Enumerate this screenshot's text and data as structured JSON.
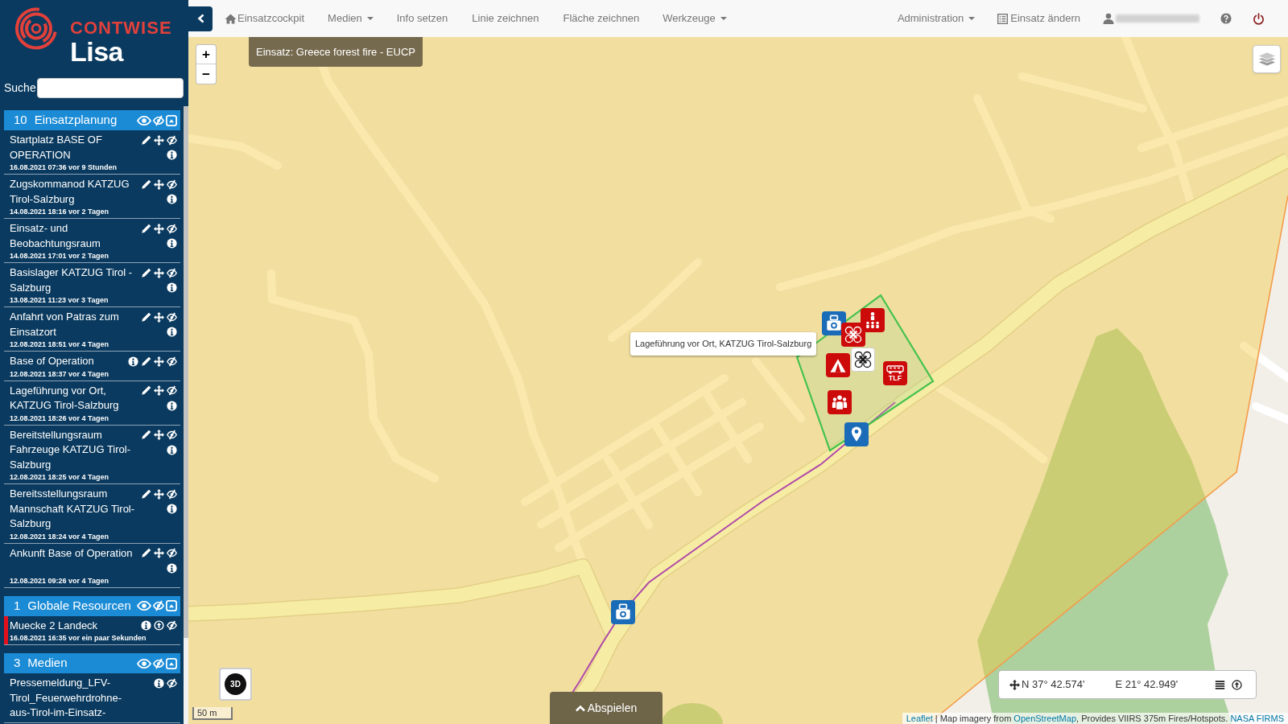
{
  "sidebar": {
    "logo": {
      "brand": "CONTWISE",
      "product": "Lisa"
    },
    "search": {
      "label": "Suche"
    },
    "groups": [
      {
        "count": "10",
        "title": "Einsatzplanung",
        "expanded": true,
        "items": [
          {
            "title": "Startplatz BASE OF OPERATION",
            "date": "16.08.2021 07:36 vor 9 Stunden",
            "kind": "feature"
          },
          {
            "title": "Zugskommanod KATZUG Tirol-Salzburg",
            "date": "14.08.2021 18:16 vor 2 Tagen",
            "kind": "feature"
          },
          {
            "title": "Einsatz- und Beobachtungsraum",
            "date": "14.08.2021 17:01 vor 2 Tagen",
            "kind": "feature"
          },
          {
            "title": "Basislager KATZUG Tirol - Salzburg",
            "date": "13.08.2021 11:23 vor 3 Tagen",
            "kind": "feature"
          },
          {
            "title": "Anfahrt von Patras zum Einsatzort",
            "date": "12.08.2021 18:51 vor 4 Tagen",
            "kind": "feature"
          },
          {
            "title": "Base of Operation",
            "date": "12.08.2021 18:37 vor 4 Tagen",
            "kind": "compact"
          },
          {
            "title": "Lageführung vor Ort, KATZUG Tirol-Salzburg",
            "date": "12.08.2021 18:26 vor 4 Tagen",
            "kind": "feature"
          },
          {
            "title": "Bereitstellungsraum Fahrzeuge KATZUG Tirol-Salzburg",
            "date": "12.08.2021 18:25 vor 4 Tagen",
            "kind": "feature"
          },
          {
            "title": "Bereitsstellungsraum Mannschaft KATZUG Tirol-Salzburg",
            "date": "12.08.2021 18:24 vor 4 Tagen",
            "kind": "feature"
          },
          {
            "title": "Ankunft Base of Operation",
            "date": "12.08.2021 09:26 vor 4 Tagen",
            "kind": "feature"
          }
        ]
      },
      {
        "count": "1",
        "title": "Globale Resourcen",
        "expanded": true,
        "items": [
          {
            "title": "Muecke 2 Landeck",
            "date": "16.08.2021 16:35 vor ein paar Sekunden",
            "kind": "resource",
            "color": "#e3101c"
          }
        ]
      },
      {
        "count": "3",
        "title": "Medien",
        "expanded": true,
        "items": [
          {
            "title": "Pressemeldung_LFV-Tirol_Feuerwehrdrohne-aus-Tirol-im-Einsatz-",
            "kind": "media"
          }
        ]
      }
    ]
  },
  "navbar": {
    "left": [
      {
        "label": "Einsatzcockpit",
        "kind": "home"
      },
      {
        "label": "Medien",
        "kind": "dropdown"
      },
      {
        "label": "Info setzen",
        "kind": "link"
      },
      {
        "label": "Linie zeichnen",
        "kind": "link"
      },
      {
        "label": "Fläche zeichnen",
        "kind": "link"
      },
      {
        "label": "Werkzeuge",
        "kind": "dropdown"
      }
    ],
    "right": [
      {
        "label": "Administration",
        "kind": "dropdown"
      },
      {
        "label": "Einsatz ändern",
        "kind": "form"
      },
      {
        "kind": "user"
      },
      {
        "kind": "help"
      },
      {
        "kind": "power"
      }
    ]
  },
  "map": {
    "mission_label": "Einsatz: Greece forest fire - EUCP",
    "zoom_controls": [
      "+",
      "−"
    ],
    "markers": [
      {
        "kind": "camera",
        "color": "#1a6cb8"
      },
      {
        "kind": "hierarchy",
        "color": "#cc0a0a"
      },
      {
        "kind": "drone",
        "color": "#cc0a0a"
      },
      {
        "kind": "drone",
        "color": "#ffffff"
      },
      {
        "kind": "tent",
        "color": "#cc0a0a"
      },
      {
        "kind": "vehicle",
        "color": "#cc0a0a",
        "label": "TLF"
      },
      {
        "kind": "people",
        "color": "#cc0a0a"
      },
      {
        "kind": "pin",
        "color": "#1a6cb8"
      },
      {
        "kind": "camera",
        "color": "#1a6cb8"
      }
    ],
    "tooltip": "Lageführung vor Ort, KATZUG Tirol-Salzburg",
    "view_button": "3D",
    "scale": "50 m",
    "play_button": "Abspielen",
    "coordinates": [
      "N 37° 42.574'",
      "E 21° 42.949'"
    ],
    "attribution": [
      {
        "text": "Leaflet",
        "link": true
      },
      {
        "text": " | Map imagery from ",
        "link": false
      },
      {
        "text": "OpenStreetMap",
        "link": true
      },
      {
        "text": ", Provides VIIRS 375m Fires/Hotspots. ",
        "link": false
      },
      {
        "text": "NASA FIRMS",
        "link": true
      }
    ]
  }
}
